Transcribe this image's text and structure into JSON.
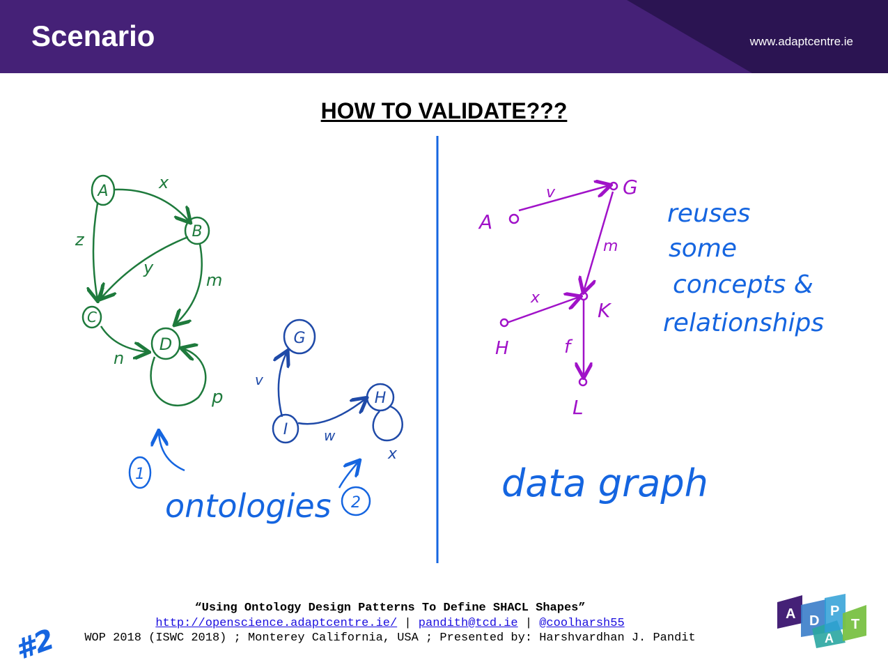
{
  "header": {
    "title": "Scenario",
    "url": "www.adaptcentre.ie",
    "colors": {
      "primary": "#452177",
      "dark": "#2b1452"
    }
  },
  "heading": "HOW TO VALIDATE???",
  "left_panel": {
    "ontology1": {
      "nodes": [
        "A",
        "B",
        "C",
        "D"
      ],
      "edge_labels": [
        "x",
        "z",
        "y",
        "m",
        "n",
        "p"
      ],
      "color": "#1e7a3c"
    },
    "ontology2": {
      "nodes": [
        "G",
        "H",
        "I"
      ],
      "edge_labels": [
        "v",
        "w",
        "x"
      ],
      "color": "#1f4aa8"
    },
    "annotation": {
      "label": "ontologies",
      "marker_1": "1",
      "marker_2": "2",
      "color": "#1565e0"
    }
  },
  "right_panel": {
    "graph": {
      "nodes": [
        "A",
        "G",
        "K",
        "H",
        "L"
      ],
      "edge_labels": [
        "v",
        "m",
        "x",
        "f"
      ],
      "color": "#a012c8"
    },
    "note_lines": [
      "reuses",
      "some",
      "concepts &",
      "relationships"
    ],
    "caption": "data graph",
    "color": "#1565e0"
  },
  "slide_number": "#2",
  "footer": {
    "title": "“Using Ontology Design Patterns To Define SHACL Shapes”",
    "link1": "http://openscience.adaptcentre.ie/",
    "sep1": " | ",
    "link2": "pandith@tcd.ie",
    "sep2": " | ",
    "link3": "@coolharsh55",
    "line3": "WOP 2018 (ISWC 2018) ; Monterey California, USA ; Presented by: Harshvardhan J. Pandit"
  },
  "logo": {
    "letters": [
      "A",
      "D",
      "A",
      "P",
      "T"
    ],
    "colors": [
      "#452177",
      "#3a7dc9",
      "#2aa6a1",
      "#2e9fd6",
      "#79c143"
    ]
  }
}
